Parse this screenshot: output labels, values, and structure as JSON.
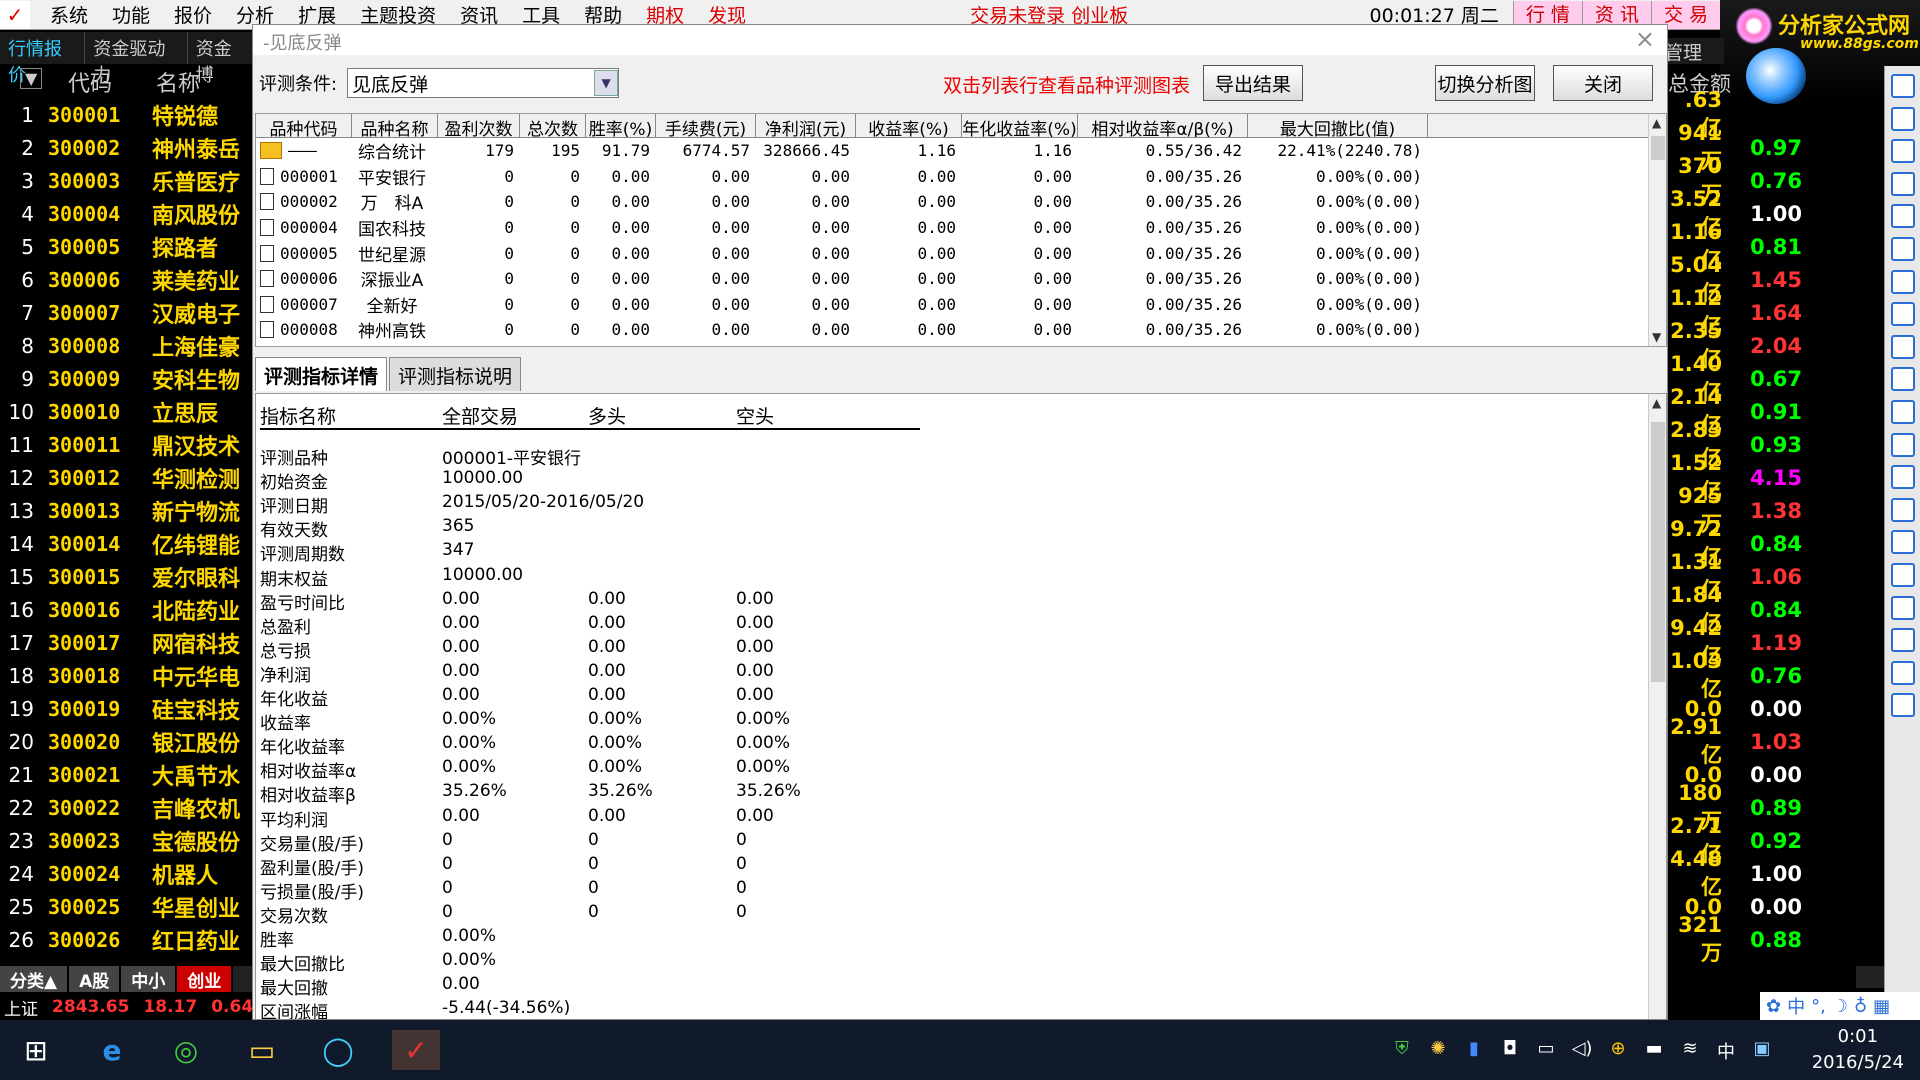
{
  "menu": {
    "logo": "✓",
    "items": [
      "系统",
      "功能",
      "报价",
      "分析",
      "扩展",
      "主题投资",
      "资讯",
      "工具",
      "帮助"
    ],
    "red_items": [
      "期权",
      "发现"
    ],
    "status": "交易未登录  创业板",
    "time": "00:01:27 周二",
    "nav": [
      "行 情",
      "资 讯",
      "交 易"
    ]
  },
  "brand": {
    "title": "分析家公式网",
    "url": "www.88gs.com"
  },
  "left_tabs": [
    "行情报价",
    "资金驱动力",
    "资金博"
  ],
  "list_header": {
    "sort": "▼",
    "code": "代码",
    "name": "名称"
  },
  "stocks": [
    {
      "n": "1",
      "code": "300001",
      "name": "特锐德",
      "amt": ".63亿",
      "chg": "",
      "color": "#ffd700"
    },
    {
      "n": "2",
      "code": "300002",
      "name": "神州泰岳",
      "amt": "941万",
      "chg": "0.97",
      "color": "#0f0"
    },
    {
      "n": "3",
      "code": "300003",
      "name": "乐普医疗",
      "amt": "370万",
      "chg": "0.76",
      "color": "#0f0"
    },
    {
      "n": "4",
      "code": "300004",
      "name": "南风股份",
      "amt": "3.52亿",
      "chg": "1.00",
      "color": "#fff"
    },
    {
      "n": "5",
      "code": "300005",
      "name": "探路者",
      "amt": "1.16亿",
      "chg": "0.81",
      "color": "#0f0"
    },
    {
      "n": "6",
      "code": "300006",
      "name": "莱美药业",
      "amt": "5.04亿",
      "chg": "1.45",
      "color": "#f33"
    },
    {
      "n": "7",
      "code": "300007",
      "name": "汉威电子",
      "amt": "1.12亿",
      "chg": "1.64",
      "color": "#f33"
    },
    {
      "n": "8",
      "code": "300008",
      "name": "上海佳豪",
      "amt": "2.35亿",
      "chg": "2.04",
      "color": "#f33"
    },
    {
      "n": "9",
      "code": "300009",
      "name": "安科生物",
      "amt": "1.40亿",
      "chg": "0.67",
      "color": "#0f0"
    },
    {
      "n": "10",
      "code": "300010",
      "name": "立思辰",
      "amt": "2.14亿",
      "chg": "0.91",
      "color": "#0f0"
    },
    {
      "n": "11",
      "code": "300011",
      "name": "鼎汉技术",
      "amt": "2.83亿",
      "chg": "0.93",
      "color": "#0f0"
    },
    {
      "n": "12",
      "code": "300012",
      "name": "华测检测",
      "amt": "1.52亿",
      "chg": "4.15",
      "color": "#f0f"
    },
    {
      "n": "13",
      "code": "300013",
      "name": "新宁物流",
      "amt": "925万",
      "chg": "1.38",
      "color": "#f33"
    },
    {
      "n": "14",
      "code": "300014",
      "name": "亿纬锂能",
      "amt": "9.72亿",
      "chg": "0.84",
      "color": "#0f0"
    },
    {
      "n": "15",
      "code": "300015",
      "name": "爱尔眼科",
      "amt": "1.31亿",
      "chg": "1.06",
      "color": "#f33"
    },
    {
      "n": "16",
      "code": "300016",
      "name": "北陆药业",
      "amt": "1.84亿",
      "chg": "0.84",
      "color": "#0f0"
    },
    {
      "n": "17",
      "code": "300017",
      "name": "网宿科技",
      "amt": "9.42亿",
      "chg": "1.19",
      "color": "#f33"
    },
    {
      "n": "18",
      "code": "300018",
      "name": "中元华电",
      "amt": "1.03亿",
      "chg": "0.76",
      "color": "#0f0"
    },
    {
      "n": "19",
      "code": "300019",
      "name": "硅宝科技",
      "amt": "0.0",
      "chg": "0.00",
      "color": "#fff"
    },
    {
      "n": "20",
      "code": "300020",
      "name": "银江股份",
      "amt": "2.91亿",
      "chg": "1.03",
      "color": "#f33"
    },
    {
      "n": "21",
      "code": "300021",
      "name": "大禹节水",
      "amt": "0.0",
      "chg": "0.00",
      "color": "#fff"
    },
    {
      "n": "22",
      "code": "300022",
      "name": "吉峰农机",
      "amt": "180万",
      "chg": "0.89",
      "color": "#0f0"
    },
    {
      "n": "23",
      "code": "300023",
      "name": "宝德股份",
      "amt": "2.71亿",
      "chg": "0.92",
      "color": "#0f0"
    },
    {
      "n": "24",
      "code": "300024",
      "name": "机器人",
      "amt": "4.48亿",
      "chg": "1.00",
      "color": "#fff"
    },
    {
      "n": "25",
      "code": "300025",
      "name": "华星创业",
      "amt": "0.0",
      "chg": "0.00",
      "color": "#fff"
    },
    {
      "n": "26",
      "code": "300026",
      "name": "红日药业",
      "amt": "321万",
      "chg": "0.88",
      "color": "#0f0"
    }
  ],
  "right_header": {
    "t1": "管理",
    "t2": "总金额"
  },
  "bottom_tabs": [
    "分类▲",
    "A股",
    "中小",
    "创业"
  ],
  "index_bar": {
    "name": "上证",
    "value": "2843.65",
    "chg": "18.17",
    "pct": "0.64"
  },
  "dialog": {
    "title": "-见底反弹",
    "condition_label": "评测条件:",
    "condition_value": "见底反弹",
    "hint": "双击列表行查看品种评测图表",
    "export_btn": "导出结果",
    "switch_btn": "切换分析图",
    "close_btn": "关闭",
    "columns": [
      "品种代码",
      "品种名称",
      "盈利次数",
      "总次数",
      "胜率(%)",
      "手续费(元)",
      "净利润(元)",
      "收益率(%)",
      "年化收益率(%)",
      "相对收益率α/β(%)",
      "最大回撤比(值)"
    ],
    "rows": [
      [
        "———",
        "综合统计",
        "179",
        "195",
        "91.79",
        "6774.57",
        "328666.45",
        "1.16",
        "1.16",
        "0.55/36.42",
        "22.41%(2240.78)"
      ],
      [
        "000001",
        "平安银行",
        "0",
        "0",
        "0.00",
        "0.00",
        "0.00",
        "0.00",
        "0.00",
        "0.00/35.26",
        "0.00%(0.00)"
      ],
      [
        "000002",
        "万　科A",
        "0",
        "0",
        "0.00",
        "0.00",
        "0.00",
        "0.00",
        "0.00",
        "0.00/35.26",
        "0.00%(0.00)"
      ],
      [
        "000004",
        "国农科技",
        "0",
        "0",
        "0.00",
        "0.00",
        "0.00",
        "0.00",
        "0.00",
        "0.00/35.26",
        "0.00%(0.00)"
      ],
      [
        "000005",
        "世纪星源",
        "0",
        "0",
        "0.00",
        "0.00",
        "0.00",
        "0.00",
        "0.00",
        "0.00/35.26",
        "0.00%(0.00)"
      ],
      [
        "000006",
        "深振业A",
        "0",
        "0",
        "0.00",
        "0.00",
        "0.00",
        "0.00",
        "0.00",
        "0.00/35.26",
        "0.00%(0.00)"
      ],
      [
        "000007",
        "全新好",
        "0",
        "0",
        "0.00",
        "0.00",
        "0.00",
        "0.00",
        "0.00",
        "0.00/35.26",
        "0.00%(0.00)"
      ],
      [
        "000008",
        "神州高铁",
        "0",
        "0",
        "0.00",
        "0.00",
        "0.00",
        "0.00",
        "0.00",
        "0.00/35.26",
        "0.00%(0.00)"
      ]
    ],
    "tabs": [
      "评测指标详情",
      "评测指标说明"
    ],
    "detail_header": [
      "指标名称",
      "全部交易",
      "多头",
      "空头"
    ],
    "detail_rows": [
      [
        "评测品种",
        "000001-平安银行",
        "",
        ""
      ],
      [
        "初始资金",
        "10000.00",
        "",
        ""
      ],
      [
        "评测日期",
        "2015/05/20-2016/05/20",
        "",
        ""
      ],
      [
        "有效天数",
        "365",
        "",
        ""
      ],
      [
        "评测周期数",
        "347",
        "",
        ""
      ],
      [
        "期末权益",
        "10000.00",
        "",
        ""
      ],
      [
        "盈亏时间比",
        "0.00",
        "0.00",
        "0.00"
      ],
      [
        "总盈利",
        "0.00",
        "0.00",
        "0.00"
      ],
      [
        "总亏损",
        "0.00",
        "0.00",
        "0.00"
      ],
      [
        "净利润",
        "0.00",
        "0.00",
        "0.00"
      ],
      [
        "年化收益",
        "0.00",
        "0.00",
        "0.00"
      ],
      [
        "收益率",
        "0.00%",
        "0.00%",
        "0.00%"
      ],
      [
        "年化收益率",
        "0.00%",
        "0.00%",
        "0.00%"
      ],
      [
        "相对收益率α",
        "0.00%",
        "0.00%",
        "0.00%"
      ],
      [
        "相对收益率β",
        "35.26%",
        "35.26%",
        "35.26%"
      ],
      [
        "平均利润",
        "0.00",
        "0.00",
        "0.00"
      ],
      [
        "交易量(股/手)",
        "0",
        "0",
        "0"
      ],
      [
        "盈利量(股/手)",
        "0",
        "0",
        "0"
      ],
      [
        "亏损量(股/手)",
        "0",
        "0",
        "0"
      ],
      [
        "交易次数",
        "0",
        "0",
        "0"
      ],
      [
        "胜率",
        "0.00%",
        "",
        ""
      ],
      [
        "最大回撤比",
        "0.00%",
        "",
        ""
      ],
      [
        "最大回撤",
        "0.00",
        "",
        ""
      ],
      [
        "区间涨幅",
        "-5.44(-34.56%)",
        "",
        ""
      ]
    ]
  },
  "taskbar": {
    "time": "0:01",
    "date": "2016/5/24",
    "ime": "中"
  }
}
